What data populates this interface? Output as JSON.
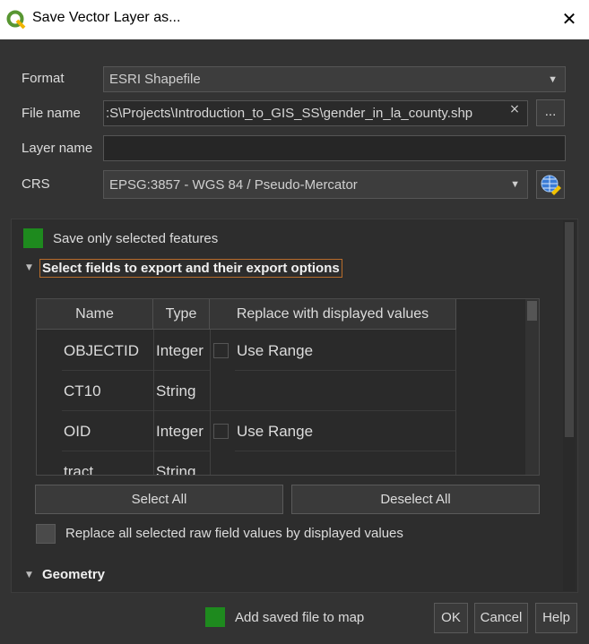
{
  "window": {
    "title": "Save Vector Layer as...",
    "close_glyph": "✕"
  },
  "form": {
    "format_label": "Format",
    "format_value": "ESRI Shapefile",
    "filename_label": "File name",
    "filename_value": ":S\\Projects\\Introduction_to_GIS_SS\\gender_in_la_county.shp",
    "filename_clear": "×",
    "browse_label": "...",
    "layername_label": "Layer name",
    "layername_value": "",
    "crs_label": "CRS",
    "crs_value": "EPSG:3857 - WGS 84 / Pseudo-Mercator",
    "dropdown_glyph": "▼"
  },
  "options": {
    "save_selected_label": "Save only selected features",
    "save_selected_checked": true,
    "fields_section_title": "Select fields to export and their export options",
    "geometry_section_title": "Geometry",
    "collapse_glyph": "▼"
  },
  "fields_table": {
    "columns": [
      "Name",
      "Type",
      "Replace with displayed values"
    ],
    "rows": [
      {
        "name": "OBJECTID",
        "type": "Integer",
        "replace": "Use Range",
        "has_checkbox": true
      },
      {
        "name": "CT10",
        "type": "String",
        "replace": "",
        "has_checkbox": false
      },
      {
        "name": "OID",
        "type": "Integer",
        "replace": "Use Range",
        "has_checkbox": true
      },
      {
        "name": "tract",
        "type": "String",
        "replace": "",
        "has_checkbox": false
      }
    ]
  },
  "buttons": {
    "select_all": "Select All",
    "deselect_all": "Deselect All",
    "ok": "OK",
    "cancel": "Cancel",
    "help": "Help"
  },
  "replace_all_label": "Replace all selected raw field values by displayed values",
  "add_to_map_label": "Add saved file to map",
  "add_to_map_checked": true,
  "colors": {
    "accent_green": "#1e8a1e",
    "background": "#333333"
  }
}
